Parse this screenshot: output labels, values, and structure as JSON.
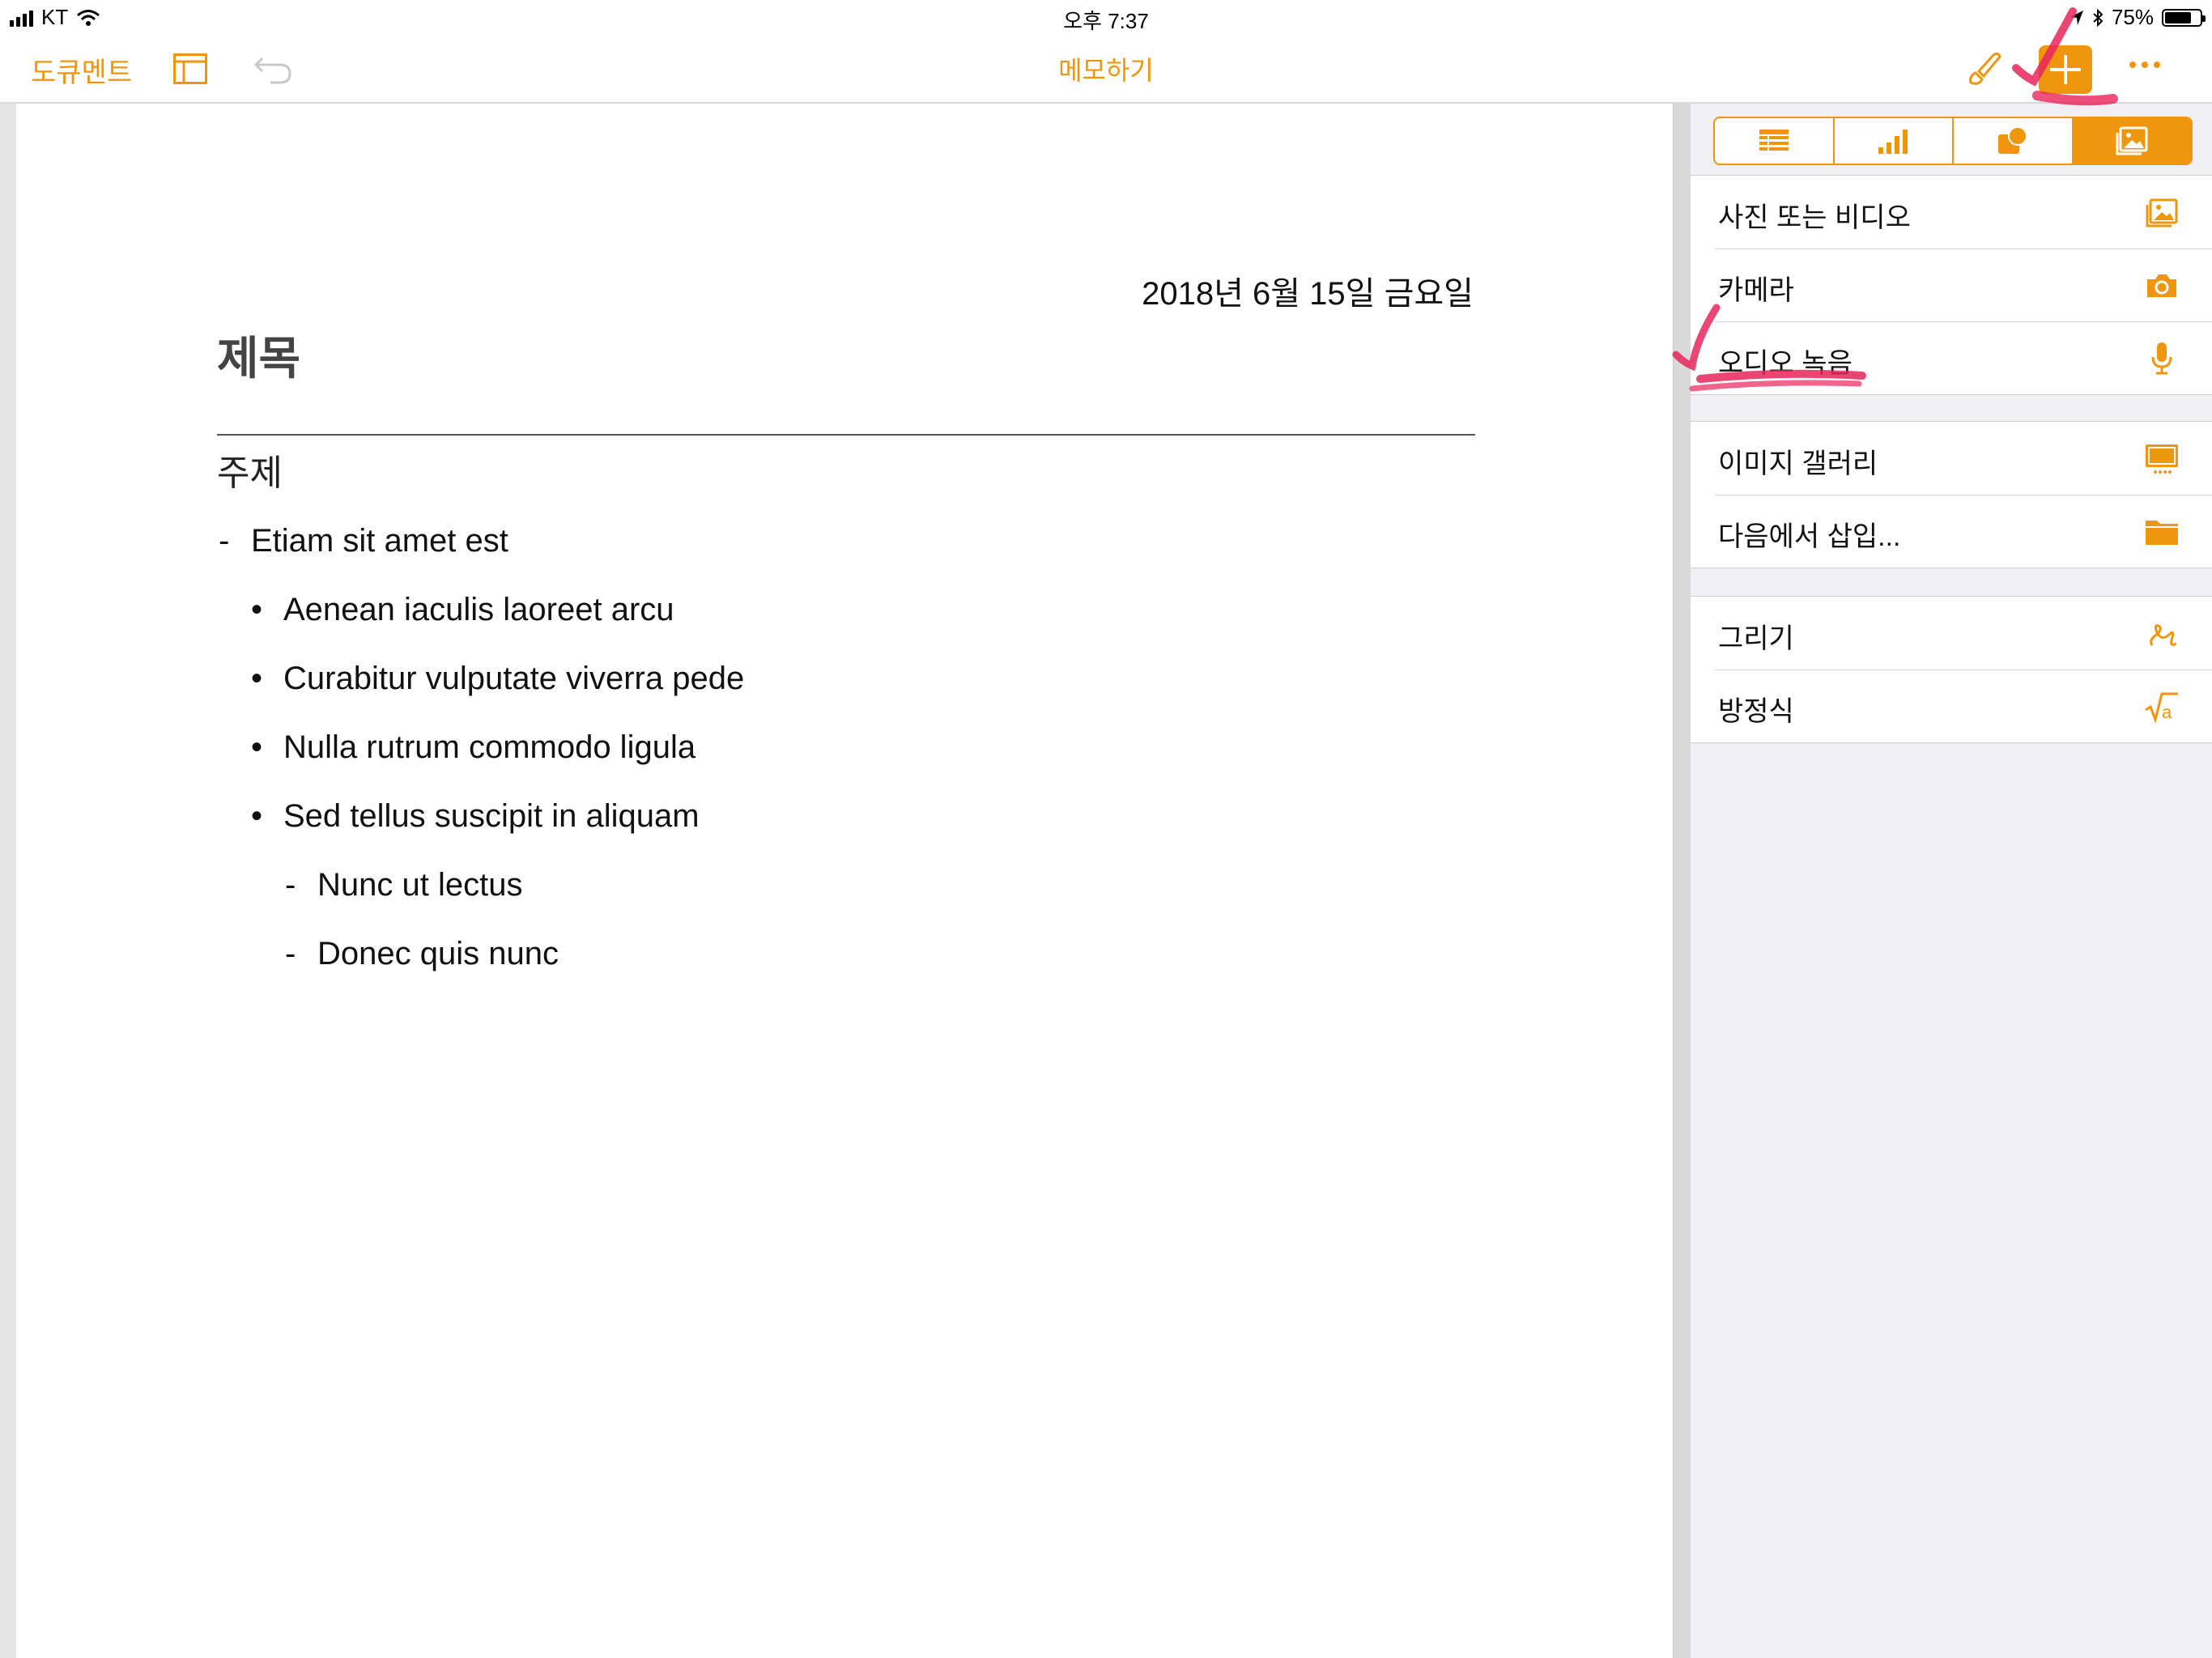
{
  "status_bar": {
    "carrier": "KT",
    "time": "오후 7:37",
    "battery_percent": "75%",
    "battery_level": 0.75
  },
  "toolbar": {
    "documents_label": "도큐멘트",
    "title": "메모하기",
    "accent_color": "#f0960e"
  },
  "document": {
    "date": "2018년 6월 15일 금요일",
    "title": "제목",
    "subject": "주제",
    "items": [
      {
        "marker": "-",
        "level": 1,
        "text": "Etiam sit amet est"
      },
      {
        "marker": "•",
        "level": 2,
        "text": "Aenean iaculis laoreet arcu"
      },
      {
        "marker": "•",
        "level": 2,
        "text": "Curabitur vulputate viverra pede"
      },
      {
        "marker": "•",
        "level": 2,
        "text": "Nulla rutrum commodo ligula"
      },
      {
        "marker": "•",
        "level": 2,
        "text": "Sed tellus suscipit in aliquam"
      },
      {
        "marker": "-",
        "level": 3,
        "text": "Nunc ut lectus"
      },
      {
        "marker": "-",
        "level": 3,
        "text": "Donec quis nunc"
      }
    ]
  },
  "insert_panel": {
    "tabs": [
      {
        "icon": "table-icon",
        "active": false
      },
      {
        "icon": "chart-icon",
        "active": false
      },
      {
        "icon": "shapes-icon",
        "active": false
      },
      {
        "icon": "media-icon",
        "active": true
      }
    ],
    "groups": [
      [
        {
          "label": "사진 또는 비디오",
          "icon": "photo-icon"
        },
        {
          "label": "카메라",
          "icon": "camera-icon"
        },
        {
          "label": "오디오 녹음",
          "icon": "microphone-icon"
        }
      ],
      [
        {
          "label": "이미지 갤러리",
          "icon": "image-gallery-icon"
        },
        {
          "label": "다음에서 삽입...",
          "icon": "folder-icon"
        }
      ],
      [
        {
          "label": "그리기",
          "icon": "drawing-icon"
        },
        {
          "label": "방정식",
          "icon": "equation-icon"
        }
      ]
    ]
  },
  "annotation_color": "#e8245a"
}
